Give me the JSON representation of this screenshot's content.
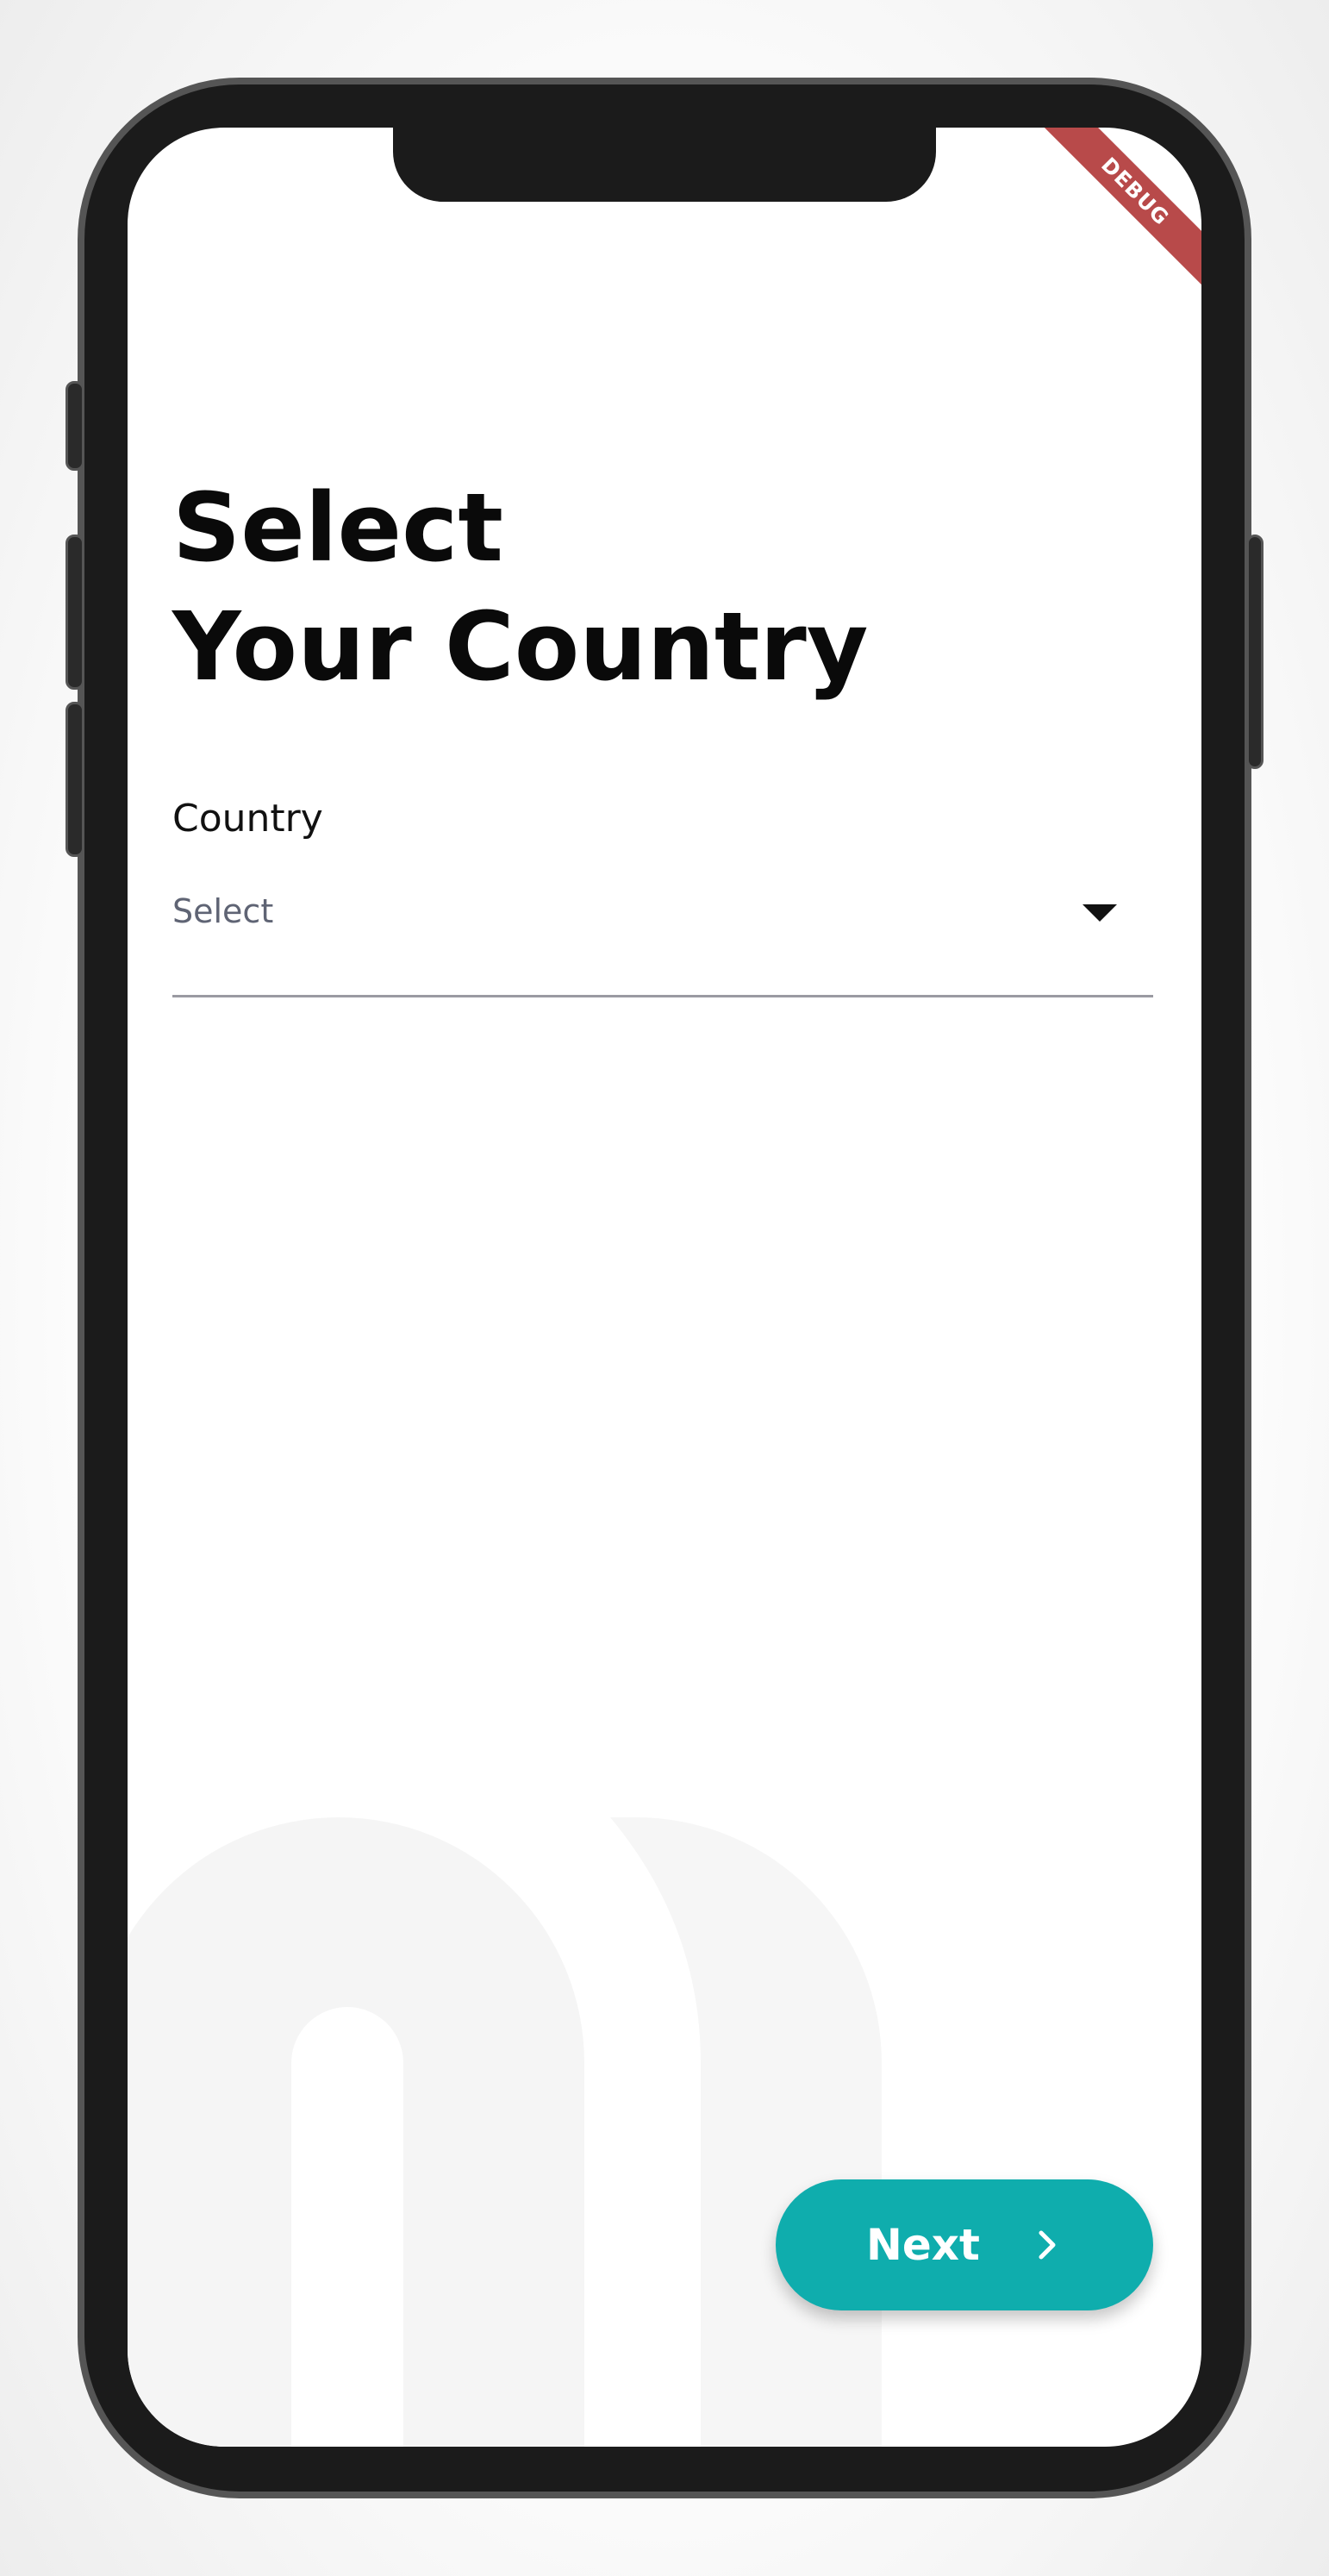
{
  "debug_banner": "DEBUG",
  "page": {
    "title_line1": "Select",
    "title_line2": "Your Country"
  },
  "country_field": {
    "label": "Country",
    "value": "Select"
  },
  "next_button": {
    "label": "Next",
    "icon": "chevron-right-icon"
  },
  "colors": {
    "accent": "#0fadad",
    "debug_ribbon": "#b84a4a",
    "text": "#0a0a0a",
    "placeholder": "#5f6474",
    "underline": "#9a9aa2",
    "bg_logo": "#f5f5f5"
  }
}
